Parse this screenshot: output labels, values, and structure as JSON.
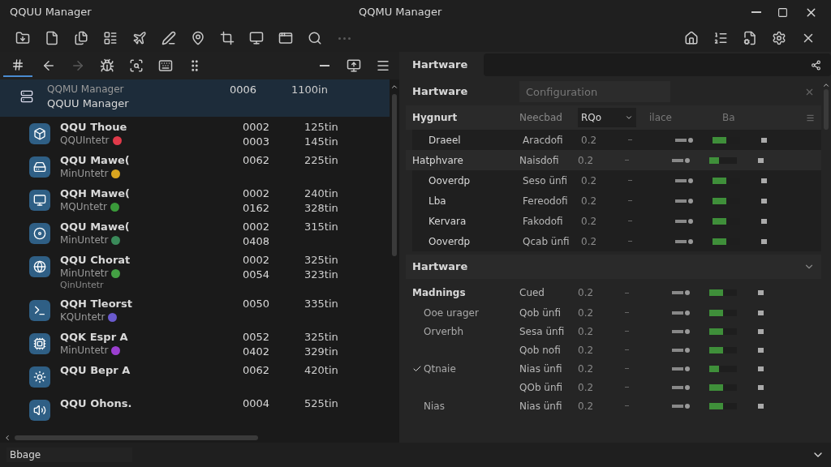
{
  "window": {
    "app_name": "QQUU Manager",
    "title": "QQMU Manager"
  },
  "list": {
    "items": [
      {
        "name": "QQMU Manager",
        "subtitle": "QQUU Manager",
        "col_2": [
          "0006"
        ],
        "col_3": [
          "1100in"
        ],
        "selected": true
      },
      {
        "name": "QQU Thoue",
        "subtitle": "QQUIntetr",
        "color": "#e03a4a",
        "col_2": [
          "0002",
          "0003"
        ],
        "col_3": [
          "125tin",
          "145tin"
        ],
        "selected": false
      },
      {
        "name": "QQU Mawe(",
        "subtitle": "MinUntetr",
        "color": "#d9a520",
        "col_2": [
          "0062"
        ],
        "col_3": [
          "225tin"
        ],
        "selected": false
      },
      {
        "name": "QQH Mawe(",
        "subtitle": "MQUntetr",
        "color": "#3a9a3a",
        "col_2": [
          "0002",
          "0162"
        ],
        "col_3": [
          "240tin",
          "328tin"
        ],
        "selected": false
      },
      {
        "name": "QQU Mawe(",
        "subtitle": "MinUntetr",
        "color": "#3a8a5a",
        "col_2": [
          "0002",
          "0408"
        ],
        "col_3": [
          "315tin"
        ],
        "selected": false
      },
      {
        "name": "QQU Chorat",
        "subtitle": "MinUntetr",
        "subtitle_2": "QinUntetr",
        "color": "#44a044",
        "col_2": [
          "0002",
          "0054"
        ],
        "col_3": [
          "325tin",
          "323tin"
        ],
        "selected": false
      },
      {
        "name": "QQH Tleorst",
        "subtitle": "KQUntetr",
        "color": "#6a5acd",
        "col_2": [
          "0050"
        ],
        "col_3": [
          "335tin"
        ],
        "selected": false
      },
      {
        "name": "QQK Espr A",
        "subtitle": "MinUntetr",
        "color": "#9b3fd0",
        "col_2": [
          "0052",
          "0402"
        ],
        "col_3": [
          "325tin",
          "329tin"
        ],
        "selected": false
      },
      {
        "name": "QQU Bepr A",
        "col_2": [
          "0062"
        ],
        "col_3": [
          "420tin"
        ],
        "selected": false
      },
      {
        "name": "QQU Ohons.",
        "col_2": [
          "0004"
        ],
        "col_3": [
          "525tin"
        ],
        "selected": false
      }
    ]
  },
  "status_bar": {
    "text": "Bbage"
  },
  "panel": {
    "tab": "Hartware",
    "section": {
      "title": "Hartware",
      "placeholder": "Configuration"
    },
    "columns": [
      "Hygnurt",
      "Neecbad",
      "RQo",
      "ilace",
      "Ba"
    ],
    "rows": [
      {
        "kind": "item",
        "name": "Draeel",
        "col_2": "Aracdofi",
        "col_3": "0.2",
        "level": 0.5
      },
      {
        "kind": "heading",
        "name": "Hatphvare",
        "col_2": "Naisdofi",
        "col_3": "0.2",
        "level": 0.35
      },
      {
        "kind": "item",
        "name": "Ooverdp",
        "col_2": "Seso ünfi",
        "col_3": "0.2",
        "level": 0.5
      },
      {
        "kind": "item",
        "name": "Lba",
        "col_2": "Fereodofi",
        "col_3": "0.2",
        "level": 0.5
      },
      {
        "kind": "item",
        "name": "Kervara",
        "col_2": "Fakodofi",
        "col_3": "0.2",
        "level": 0.5
      },
      {
        "kind": "item",
        "name": "Ooverdp",
        "col_2": "Qcab ünfi",
        "col_3": "0.2",
        "level": 0.5
      }
    ],
    "collapsed_section": {
      "title": "Hartware",
      "expanded": false
    },
    "group": {
      "title": "Madnings",
      "col_2": "Cued",
      "col_3": "0.2",
      "level": 0.5,
      "rows": [
        {
          "name": "Ooe urager",
          "col_2": "Qob ünfi",
          "col_3": "0.2",
          "level": 0.5,
          "checked": false
        },
        {
          "name": "Orverbh",
          "col_2": "Sesa ünfi",
          "col_3": "0.2",
          "level": 0.5,
          "checked": false
        },
        {
          "col_2": "Qob nofi",
          "col_3": "0.2",
          "level": 0.5,
          "checked": false
        },
        {
          "name": "Qtnaie",
          "col_2": "Nias ünfi",
          "col_3": "0.2",
          "level": 0.35,
          "checked": true
        },
        {
          "col_2": "QOb ünfi",
          "col_3": "0.2",
          "level": 0.5,
          "checked": false
        },
        {
          "name": "Nias",
          "col_2": "Nias ünfi",
          "col_3": "0.2",
          "level": 0.5,
          "checked": false
        }
      ]
    }
  }
}
